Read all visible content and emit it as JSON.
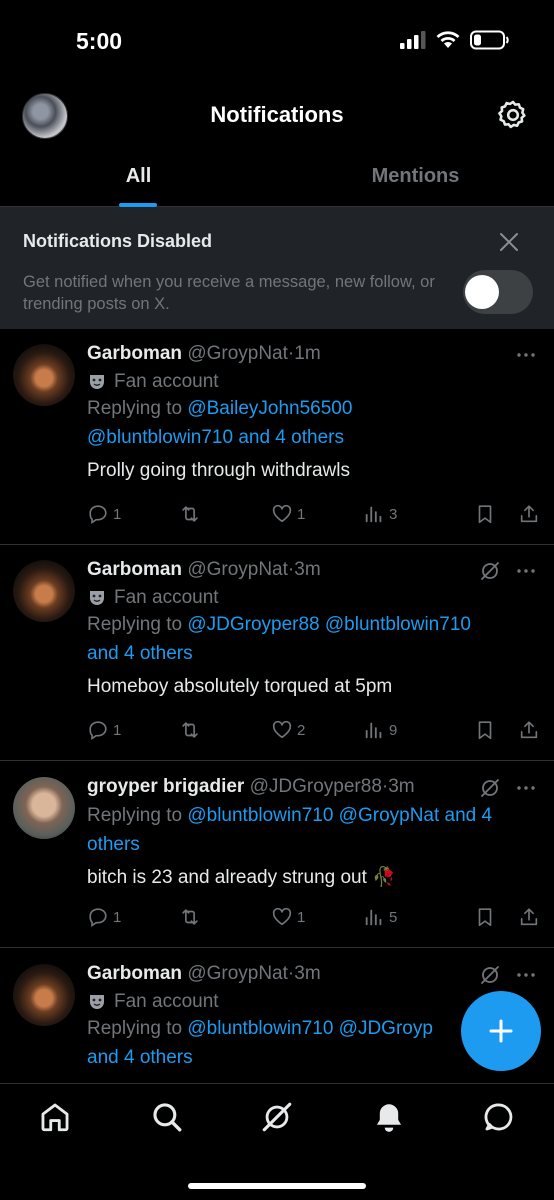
{
  "status_bar": {
    "time": "5:00"
  },
  "header": {
    "title": "Notifications"
  },
  "tabs": [
    {
      "label": "All",
      "active": true
    },
    {
      "label": "Mentions",
      "active": false
    }
  ],
  "banner": {
    "title": "Notifications Disabled",
    "text": "Get notified when you receive a message, new follow, or trending posts on X.",
    "toggle_on": false
  },
  "tweets": [
    {
      "name": "Garboman",
      "handle": "@GroypNat",
      "sep": "·",
      "time": "1m",
      "badge": "Fan account",
      "replying_prefix": "Replying to",
      "replying_to": "@BaileyJohn56500",
      "replying_rest": "@bluntblowin710 and 4 others",
      "text": "Prolly going through withdrawls",
      "replies": "1",
      "likes": "1",
      "views": "3"
    },
    {
      "name": "Garboman",
      "handle": "@GroypNat",
      "sep": "·",
      "time": "3m",
      "badge": "Fan account",
      "replying_prefix": "Replying to",
      "replying_to": "@JDGroyper88 @bluntblowin710",
      "replying_rest": "and 4 others",
      "text": "Homeboy absolutely torqued at 5pm",
      "replies": "1",
      "likes": "2",
      "views": "9"
    },
    {
      "name": "groyper brigadier",
      "handle": "@JDGroyper88",
      "sep": "·",
      "time": "3m",
      "replying_prefix": "Replying to",
      "replying_to": "@bluntblowin710 @GroypNat and 4",
      "replying_rest": "others",
      "text": "bitch is 23 and already strung out",
      "emoji": "🥀",
      "replies": "1",
      "likes": "1",
      "views": "5"
    },
    {
      "name": "Garboman",
      "handle": "@GroypNat",
      "sep": "·",
      "time": "3m",
      "badge": "Fan account",
      "replying_prefix": "Replying to",
      "replying_to": "@bluntblowin710 @JDGroyp",
      "replying_rest": "and 4 others"
    }
  ],
  "icons": {
    "home": "home-icon",
    "search": "search-icon",
    "grok": "grok-icon",
    "bell": "bell-icon",
    "messages": "message-icon",
    "compose": "plus-icon"
  },
  "colors": {
    "accent": "#1d9bf0",
    "muted": "#71767b",
    "banner_bg": "#202327"
  }
}
